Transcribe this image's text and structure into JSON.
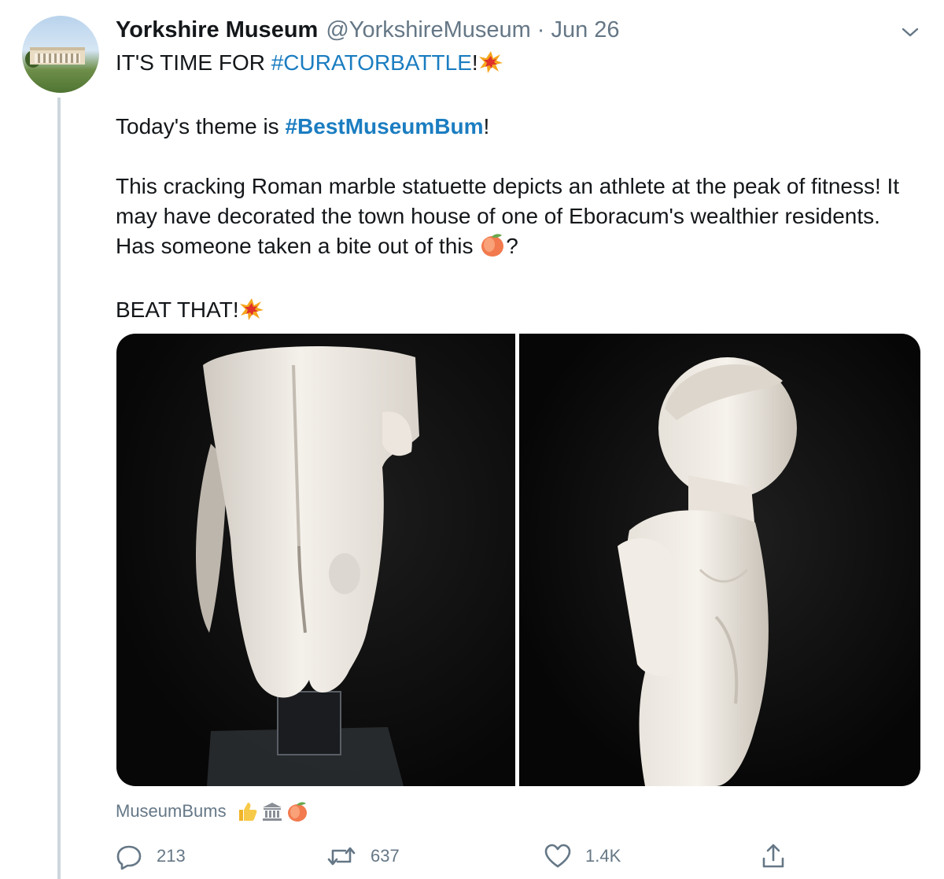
{
  "tweet": {
    "display_name": "Yorkshire Museum",
    "handle": "@YorkshireMuseum",
    "separator": "·",
    "date": "Jun 26",
    "line1_prefix": "IT'S TIME FOR ",
    "line1_tag": "#CURATORBATTLE",
    "line1_suffix": "!",
    "line2_prefix": "Today's theme is ",
    "line2_tag": "#BestMuseumBum",
    "line2_suffix": "!",
    "para1": "This cracking Roman marble statuette depicts an athlete at the peak of fitness! It may have decorated the town house of one of Eboracum's wealthier residents. Has someone taken a bite out of this",
    "para1_end": "?",
    "closing": "BEAT THAT!"
  },
  "attribution": {
    "label": "MuseumBums",
    "icons": [
      "thumbs-up-icon",
      "classical-building-icon",
      "peach-icon"
    ]
  },
  "actions": {
    "reply_count": "213",
    "retweet_count": "637",
    "like_count": "1.4K"
  },
  "colors": {
    "link": "#1b7dc1",
    "secondary_text": "#657786",
    "thread_line": "#ccd6dd"
  }
}
